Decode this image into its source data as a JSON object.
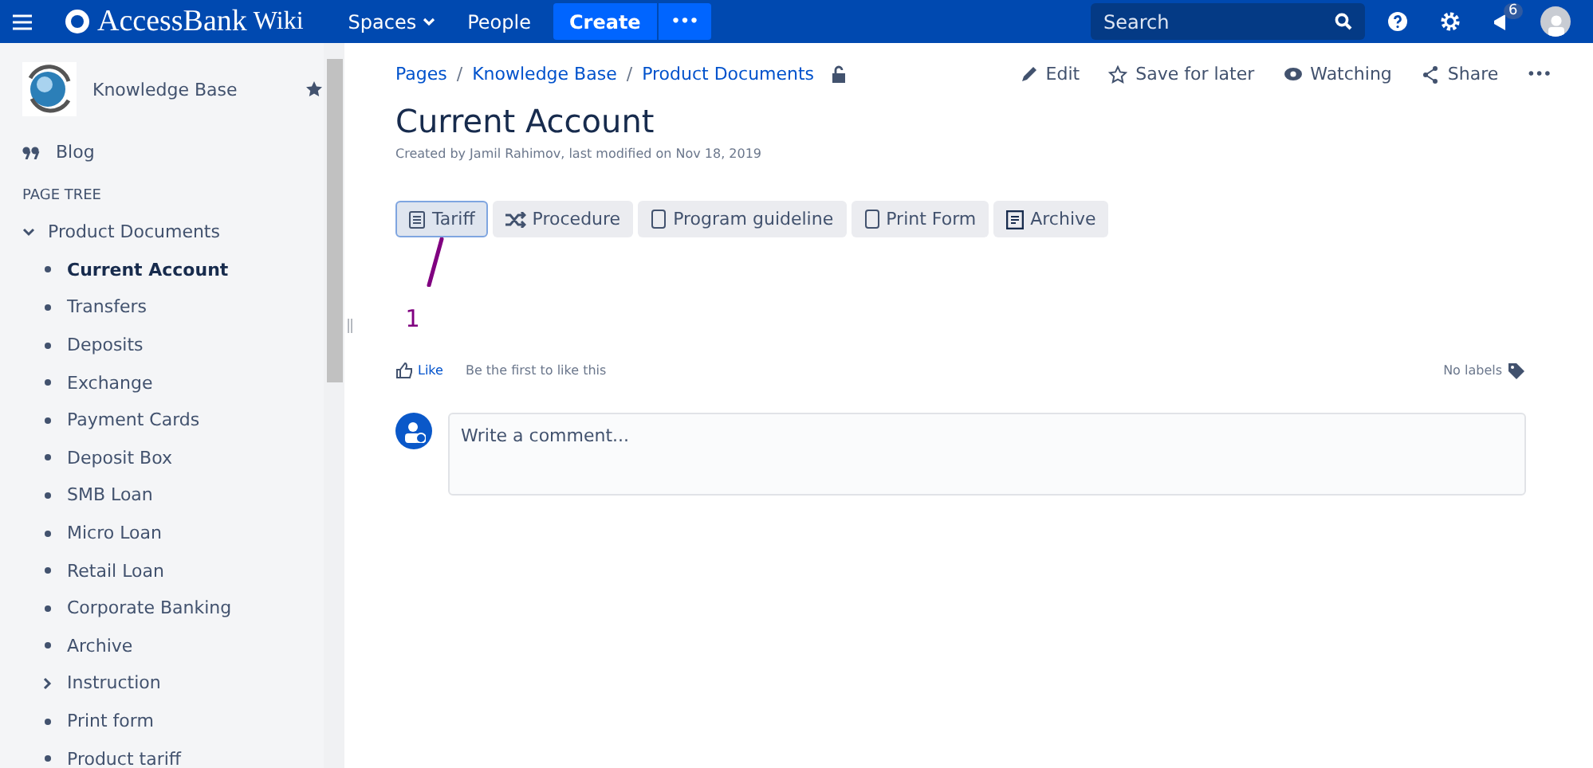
{
  "topbar": {
    "logo": "AccessBank",
    "logo_suffix": "Wiki",
    "nav": [
      {
        "label": "Spaces",
        "dropdown": true
      },
      {
        "label": "People",
        "dropdown": false
      }
    ],
    "create": "Create",
    "more": "•••",
    "search": {
      "placeholder": "Search"
    },
    "notifications": "6"
  },
  "sidebar": {
    "space": "Knowledge Base",
    "blog": "Blog",
    "section": "PAGE TREE",
    "tree": [
      {
        "label": "Product Documents",
        "expanded": true,
        "selected": false,
        "children": [
          {
            "label": "Current Account",
            "selected": true,
            "kind": "leaf"
          },
          {
            "label": "Transfers",
            "selected": false,
            "kind": "leaf"
          },
          {
            "label": "Deposits",
            "selected": false,
            "kind": "leaf"
          },
          {
            "label": "Exchange",
            "selected": false,
            "kind": "leaf"
          },
          {
            "label": "Payment Cards",
            "selected": false,
            "kind": "leaf"
          },
          {
            "label": "Deposit Box",
            "selected": false,
            "kind": "leaf"
          },
          {
            "label": "SMB Loan",
            "selected": false,
            "kind": "leaf"
          },
          {
            "label": "Micro Loan",
            "selected": false,
            "kind": "leaf"
          },
          {
            "label": "Retail Loan",
            "selected": false,
            "kind": "leaf"
          },
          {
            "label": "Corporate Banking",
            "selected": false,
            "kind": "leaf"
          },
          {
            "label": "Archive",
            "selected": false,
            "kind": "leaf"
          },
          {
            "label": "Instruction",
            "selected": false,
            "kind": "folder",
            "expanded": false
          },
          {
            "label": "Print form",
            "selected": false,
            "kind": "leaf"
          },
          {
            "label": "Product tariff",
            "selected": false,
            "kind": "leaf"
          }
        ]
      }
    ]
  },
  "breadcrumbs": [
    "Pages",
    "Knowledge Base",
    "Product Documents"
  ],
  "breadcrumb_separator": "/",
  "actions": [
    {
      "label": "Edit",
      "kind": "edit"
    },
    {
      "label": "Save for later",
      "kind": "star"
    },
    {
      "label": "Watching",
      "kind": "eye"
    },
    {
      "label": "Share",
      "kind": "share"
    },
    {
      "label": "•••",
      "kind": "more"
    }
  ],
  "page": {
    "title": "Current Account",
    "byline": "Created by Jamil Rahimov, last modified on Nov 18, 2019"
  },
  "buttons": [
    {
      "label": "Tariff",
      "kind": "doc",
      "selected": true
    },
    {
      "label": "Procedure",
      "kind": "shuffle",
      "selected": false
    },
    {
      "label": "Program guideline",
      "kind": "page",
      "selected": false
    },
    {
      "label": "Print Form",
      "kind": "page",
      "selected": false
    },
    {
      "label": "Archive",
      "kind": "list",
      "selected": false
    }
  ],
  "annotation": "1",
  "like": {
    "label": "Like",
    "note": "Be the first to like this"
  },
  "labels": "No labels",
  "comment": {
    "placeholder": "Write a comment..."
  }
}
